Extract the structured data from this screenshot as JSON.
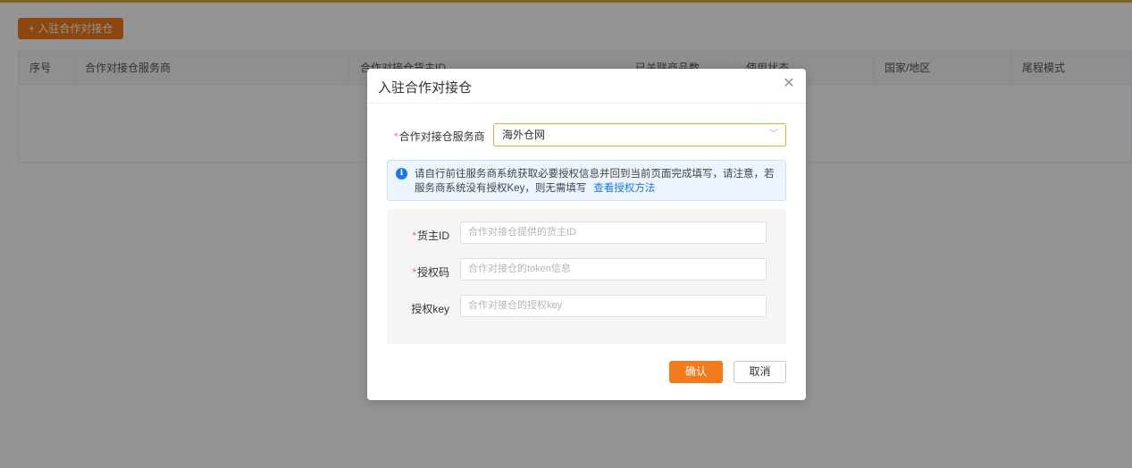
{
  "page": {
    "add_button_label": "+ 入驻合作对接仓"
  },
  "table": {
    "columns": [
      "序号",
      "合作对接仓服务商",
      "合作对接仓货主ID",
      "已关联商品数",
      "使用状态",
      "国家/地区",
      "尾程模式"
    ]
  },
  "dialog": {
    "title": "入驻合作对接仓",
    "provider_label": "合作对接仓服务商",
    "provider_value": "海外仓网",
    "alert_text": "请自行前往服务商系统获取必要授权信息并回到当前页面完成填写，请注意，若服务商系统没有授权Key，则无需填写",
    "alert_link": "查看授权方法",
    "fields": [
      {
        "label": "货主ID",
        "required": "*",
        "placeholder": "合作对接仓提供的货主ID"
      },
      {
        "label": "授权码",
        "required": "*",
        "placeholder": "合作对接仓的token信息"
      },
      {
        "label": "授权key",
        "required": "",
        "placeholder": "合作对接仓的授权key"
      }
    ],
    "confirm_label": "确认",
    "cancel_label": "取消"
  },
  "colors": {
    "accent": "#f17b1d",
    "link": "#1a78e0",
    "required": "#f56c6c"
  }
}
